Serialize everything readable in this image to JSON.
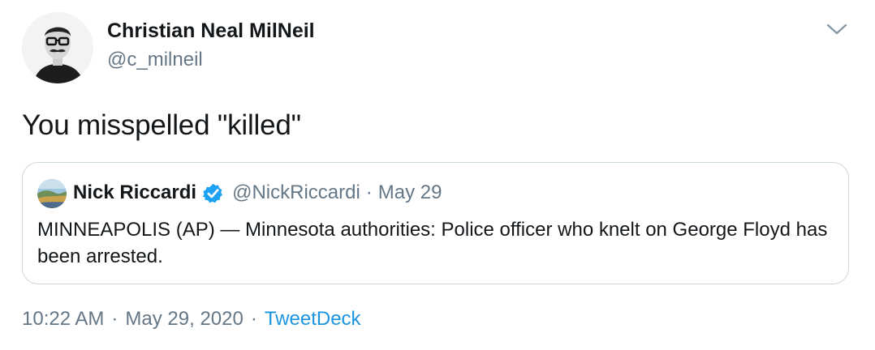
{
  "author": {
    "name": "Christian Neal MilNeil",
    "handle": "@c_milneil"
  },
  "tweet": {
    "text": "You misspelled \"killed\""
  },
  "quoted_tweet": {
    "author_name": "Nick Riccardi",
    "handle": "@NickRiccardi",
    "separator": "·",
    "date": "May 29",
    "text": "MINNEAPOLIS (AP) — Minnesota authorities: Police officer who knelt on George Floyd has been arrested."
  },
  "meta": {
    "time": "10:22 AM",
    "separator": "·",
    "date": "May 29, 2020",
    "source": "TweetDeck"
  },
  "icons": {
    "caret": "chevron-down-icon",
    "verified": "verified-badge-icon"
  },
  "colors": {
    "accent": "#1b95e0",
    "secondary_text": "#657786",
    "primary_text": "#14171a",
    "border": "#ccd6dd",
    "verified": "#1da1f2"
  }
}
